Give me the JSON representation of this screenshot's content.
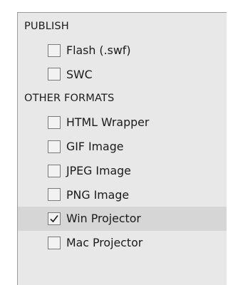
{
  "sections": [
    {
      "label": "PUBLISH",
      "items": [
        {
          "label": "Flash (.swf)",
          "checked": false,
          "selected": false
        },
        {
          "label": "SWC",
          "checked": false,
          "selected": false
        }
      ]
    },
    {
      "label": "OTHER FORMATS",
      "items": [
        {
          "label": "HTML Wrapper",
          "checked": false,
          "selected": false
        },
        {
          "label": "GIF Image",
          "checked": false,
          "selected": false
        },
        {
          "label": "JPEG Image",
          "checked": false,
          "selected": false
        },
        {
          "label": "PNG Image",
          "checked": false,
          "selected": false
        },
        {
          "label": "Win Projector",
          "checked": true,
          "selected": true
        },
        {
          "label": "Mac Projector",
          "checked": false,
          "selected": false
        }
      ]
    }
  ],
  "colors": {
    "panel_bg": "#e8e8e8",
    "selected_row_bg": "#d6d6d6",
    "checkbox_border": "#7a7a7a",
    "checkmark": "#1a1a1a"
  }
}
